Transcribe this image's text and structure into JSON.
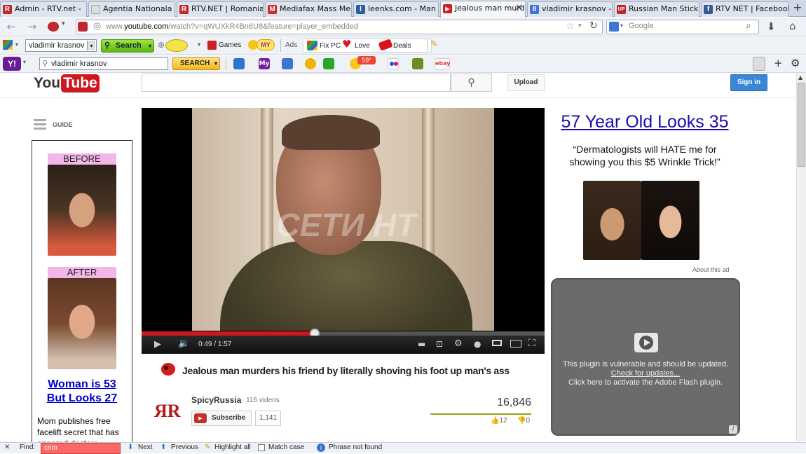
{
  "tabs": [
    {
      "label": "Admin - RTV.net -",
      "favicon": "R",
      "color": "#c0262d"
    },
    {
      "label": "Agentia Nationala de ...",
      "favicon": "",
      "color": "#dddddd"
    },
    {
      "label": "RTV.NET | Romania T...",
      "favicon": "R",
      "color": "#c0262d"
    },
    {
      "label": "Mediafax Mass Media...",
      "favicon": "M",
      "color": "#d62828"
    },
    {
      "label": "leenks.com - Man Die...",
      "favicon": "l",
      "color": "#2a5e9c"
    },
    {
      "label": "Jealous man murd...",
      "favicon": "▶",
      "color": "#d2201d",
      "active": true
    },
    {
      "label": "vladimir krasnov - Că...",
      "favicon": "8",
      "color": "#3d74d6"
    },
    {
      "label": "Russian Man Sticks F...",
      "favicon": "UP",
      "color": "#c0262d"
    },
    {
      "label": "RTV NET | Facebook",
      "favicon": "f",
      "color": "#3b5998"
    }
  ],
  "nav": {
    "url_prefix": "www.",
    "url_domain": "youtube.com",
    "url_rest": "/watch?v=qWUXkR4Bn6U8&feature=player_embedded",
    "search_placeholder": "Google"
  },
  "toolbar1": {
    "search_value": "vladimir krasnov",
    "search_button": "Search",
    "games": "Games",
    "my": "MY",
    "ads": "Ads",
    "fixpc": "Fix PC",
    "love": "Love",
    "deals": "Deals"
  },
  "toolbar2": {
    "search_value": "vladimir krasnov",
    "search_button": "SEARCH",
    "weather": "59°"
  },
  "youtube": {
    "logo_you": "You",
    "logo_tube": "Tube",
    "upload": "Upload",
    "signin": "Sign in",
    "guide": "GUIDE"
  },
  "left_ad": {
    "before": "BEFORE",
    "after": "AFTER",
    "headline_line1": "Woman is 53",
    "headline_line2": "But Looks 27",
    "body": "Mom publishes free facelift secret that has angered doctors"
  },
  "player": {
    "watermark": "СЕТИ НТ",
    "time_current": "0:49",
    "time_total": "1:57",
    "progress_fraction": 0.43
  },
  "video": {
    "title": "Jealous man murders his friend by literally shoving his foot up man's ass",
    "channel": "SpicyRussia",
    "video_count": "116 videos",
    "subscribe": "Subscribe",
    "subscribers": "1,141",
    "views": "16,846",
    "likes": "12",
    "dislikes": "0",
    "channel_logo": "ЯR"
  },
  "right_ad": {
    "headline": "57 Year Old Looks 35",
    "body": "“Dermatologists will HATE me for showing you this $5 Wrinkle Trick!”",
    "about": "About this ad"
  },
  "plugin": {
    "line1": "This plugin is vulnerable and should be updated.",
    "link": "Check for updates...",
    "line2": "Click here to activate the Adobe Flash plugin."
  },
  "findbar": {
    "label": "Find:",
    "value": "crim",
    "next": "Next",
    "previous": "Previous",
    "highlight": "Highlight all",
    "matchcase": "Match case",
    "status": "Phrase not found"
  }
}
